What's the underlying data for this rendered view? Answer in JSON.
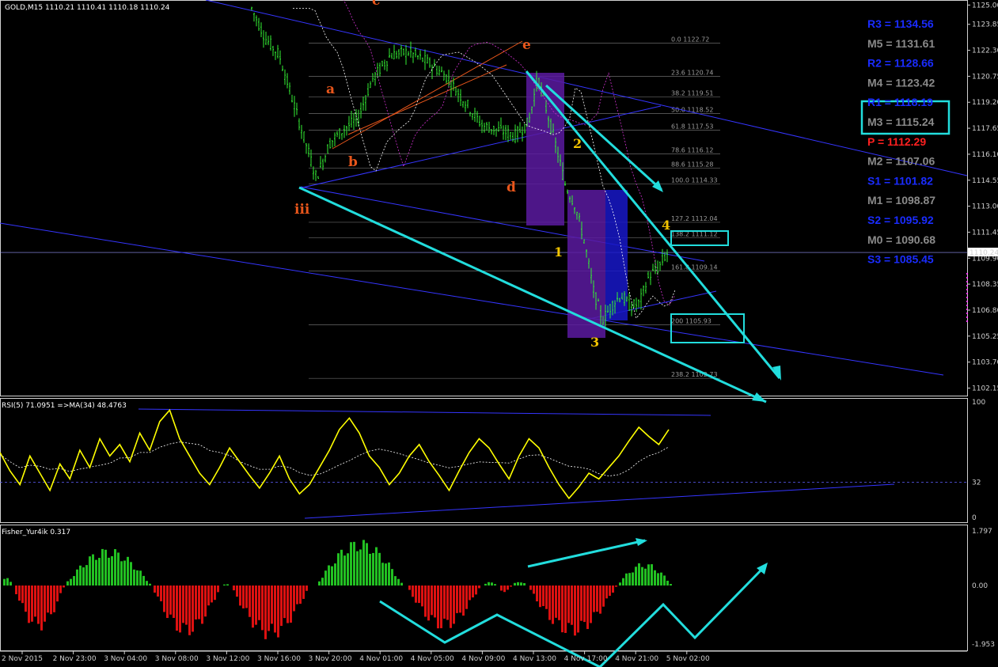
{
  "chart_data": [
    {
      "type": "candlestick",
      "header": "GOLD,M15  1110.21 1110.41 1110.18 1110.24",
      "price_axis": {
        "ticks": [
          "1125.00",
          "1123.85",
          "1122.30",
          "1120.75",
          "1119.20",
          "1117.65",
          "1116.10",
          "1114.55",
          "1113.00",
          "1111.45",
          "1109.90",
          "1108.35",
          "1106.80",
          "1105.25",
          "1103.70",
          "1102.15"
        ],
        "ylim": [
          1101.7,
          1125.3
        ],
        "current_price": "1110.24"
      },
      "x_axis_ticks": [
        "2 Nov 2015",
        "2 Nov 23:00",
        "3 Nov 04:00",
        "3 Nov 08:00",
        "3 Nov 12:00",
        "3 Nov 16:00",
        "3 Nov 20:00",
        "4 Nov 01:00",
        "4 Nov 05:00",
        "4 Nov 09:00",
        "4 Nov 13:00",
        "4 Nov 17:00",
        "4 Nov 21:00",
        "5 Nov 02:00"
      ],
      "price_path": [
        {
          "x": 0,
          "y": 1124.8
        },
        {
          "x": 3,
          "y": 1123.0
        },
        {
          "x": 6,
          "y": 1122.0
        },
        {
          "x": 9,
          "y": 1119.2
        },
        {
          "x": 12,
          "y": 1116.5
        },
        {
          "x": 14,
          "y": 1114.7
        },
        {
          "x": 17,
          "y": 1116.8
        },
        {
          "x": 20,
          "y": 1117.6
        },
        {
          "x": 23,
          "y": 1118.2
        },
        {
          "x": 26,
          "y": 1120.5
        },
        {
          "x": 30,
          "y": 1122.0
        },
        {
          "x": 34,
          "y": 1122.2
        },
        {
          "x": 38,
          "y": 1121.6
        },
        {
          "x": 42,
          "y": 1120.8
        },
        {
          "x": 46,
          "y": 1119.3
        },
        {
          "x": 50,
          "y": 1117.8
        },
        {
          "x": 54,
          "y": 1117.5
        },
        {
          "x": 57,
          "y": 1117.2
        },
        {
          "x": 60,
          "y": 1118.0
        },
        {
          "x": 62,
          "y": 1120.7
        },
        {
          "x": 64,
          "y": 1118.6
        },
        {
          "x": 66,
          "y": 1116.5
        },
        {
          "x": 68,
          "y": 1114.2
        },
        {
          "x": 70,
          "y": 1113.1
        },
        {
          "x": 72,
          "y": 1111.0
        },
        {
          "x": 74,
          "y": 1108.0
        },
        {
          "x": 76,
          "y": 1106.2
        },
        {
          "x": 78,
          "y": 1107.1
        },
        {
          "x": 80,
          "y": 1107.7
        },
        {
          "x": 82,
          "y": 1107.0
        },
        {
          "x": 84,
          "y": 1107.2
        },
        {
          "x": 86,
          "y": 1108.8
        },
        {
          "x": 88,
          "y": 1109.3
        },
        {
          "x": 90,
          "y": 1110.2
        }
      ],
      "fibonacci_levels": [
        {
          "label": "0.0  1122.72",
          "price": 1122.72
        },
        {
          "label": "23.6  1120.74",
          "price": 1120.74
        },
        {
          "label": "38.2  1119.51",
          "price": 1119.51
        },
        {
          "label": "50.0  1118.52",
          "price": 1118.52
        },
        {
          "label": "61.8  1117.53",
          "price": 1117.53
        },
        {
          "label": "78.6  1116.12",
          "price": 1116.12
        },
        {
          "label": "88.6  1115.28",
          "price": 1115.28
        },
        {
          "label": "100.0  1114.33",
          "price": 1114.33
        },
        {
          "label": "127.2  1112.04",
          "price": 1112.04
        },
        {
          "label": "138.2  1111.12",
          "price": 1111.12
        },
        {
          "label": "161.8  1109.14",
          "price": 1109.14
        },
        {
          "label": "200  1105.93",
          "price": 1105.93
        },
        {
          "label": "238.2  1102.73",
          "price": 1102.73
        }
      ],
      "wave_labels_orange": [
        "a",
        "b",
        "c",
        "d",
        "e",
        "iii"
      ],
      "wave_labels_yellow": [
        "1",
        "2",
        "3",
        "4"
      ],
      "pivots": [
        {
          "label": "R3 = 1134.56",
          "color": "#1a2cff"
        },
        {
          "label": "M5 = 1131.61",
          "color": "#8a8a8a"
        },
        {
          "label": "R2 = 1128.66",
          "color": "#1a2cff"
        },
        {
          "label": "M4 = 1123.42",
          "color": "#8a8a8a"
        },
        {
          "label": "R1 = 1118.19",
          "color": "#1a2cff"
        },
        {
          "label": "M3 = 1115.24",
          "color": "#8a8a8a"
        },
        {
          "label": "P   = 1112.29",
          "color": "#ff2020"
        },
        {
          "label": "M2 = 1107.06",
          "color": "#8a8a8a"
        },
        {
          "label": "S1 = 1101.82",
          "color": "#1a2cff"
        },
        {
          "label": "M1 = 1098.87",
          "color": "#8a8a8a"
        },
        {
          "label": "S2 = 1095.92",
          "color": "#1a2cff"
        },
        {
          "label": "M0 = 1090.68",
          "color": "#8a8a8a"
        },
        {
          "label": "S3 = 1085.45",
          "color": "#1a2cff"
        }
      ]
    },
    {
      "type": "line",
      "header": "RSI(5) 71.0951  =>MA(34) 48.4763",
      "axis_ticks": [
        "100",
        "32",
        "0"
      ],
      "ylim": [
        0,
        100
      ],
      "reference_level": 32,
      "series": [
        {
          "color": "#ffff00",
          "values": [
            58,
            42,
            30,
            55,
            40,
            25,
            48,
            35,
            60,
            45,
            70,
            55,
            65,
            50,
            75,
            60,
            85,
            95,
            70,
            55,
            40,
            30,
            45,
            62,
            50,
            38,
            27,
            40,
            55,
            35,
            22,
            30,
            45,
            60,
            78,
            88,
            75,
            55,
            45,
            30,
            40,
            55,
            65,
            50,
            38,
            25,
            42,
            58,
            70,
            62,
            48,
            35,
            55,
            70,
            62,
            45,
            30,
            18,
            28,
            40,
            35,
            45,
            55,
            68,
            80,
            72,
            65,
            78
          ]
        }
      ]
    },
    {
      "type": "histogram",
      "header": "Fisher_Yur4ik 0.317",
      "axis_ticks": [
        "1.797",
        "0.00",
        "-1.953"
      ],
      "ylim": [
        -1.953,
        1.797
      ],
      "colors": {
        "positive": "#22c022",
        "negative": "#dd1111"
      }
    }
  ],
  "colors": {
    "background": "#000000",
    "candle": "#33ee33",
    "annotation": "#22dddd",
    "trendline": "#3535ff"
  }
}
